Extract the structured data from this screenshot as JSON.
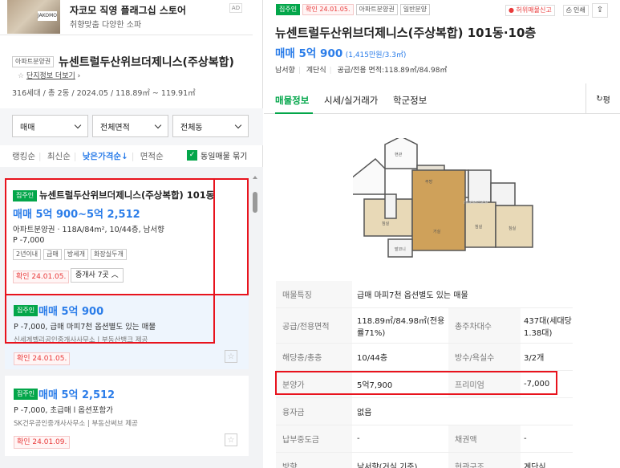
{
  "left": {
    "store": {
      "title": "자코모 직영 플래그십 스토어",
      "subtitle": "취향맞춤 다양한 소파",
      "logo_text": "JAKOMO"
    },
    "listing": {
      "type_tag": "아파트분양권",
      "name": "뉴센트럴두산위브더제니스(주상복합)",
      "complex_link": "단지정보 더보기",
      "summary": "316세대 / 총 2동 / 2024.05 / 118.89㎡ ~ 119.91㎡"
    },
    "filters": {
      "deal": "매매",
      "area": "전체면적",
      "dong": "전체동"
    },
    "sort": {
      "items": [
        "랭킹순",
        "최신순",
        "낮은가격순↓",
        "면적순"
      ],
      "group_label": "동일매물 묶기"
    },
    "cards": [
      {
        "badge": "집주인",
        "title": "뉴센트럴두산위브더제니스(주상복합) 101동",
        "price": "매매 5억 900~5억 2,512",
        "spec": "아파트분양권 · 118A/84m², 10/44층, 남서향",
        "premium": "P -7,000",
        "tags": [
          "2년이내",
          "급매",
          "방세개",
          "화장실두개"
        ],
        "confirm": "확인 24.01.05.",
        "agents": "중개사 7곳"
      },
      {
        "badge": "집주인",
        "price": "매매 5억 900",
        "desc": "P -7,000, 급매 마피7천 옵션별도 있는 매물",
        "provider": "신세계벨리공인중개사사무소 | 부동산뱅크 제공",
        "confirm": "확인 24.01.05."
      },
      {
        "badge": "집주인",
        "price": "매매 5억 2,512",
        "desc": "P -7,000, 초급매 l 옵션포함가",
        "provider": "SK건우공인중개사사무소 | 부동산써브 제공",
        "confirm": "확인 24.01.09."
      }
    ]
  },
  "right": {
    "badges": [
      "집주인",
      "확인 24.01.05.",
      "아파트분양권",
      "일반분양"
    ],
    "report": "허위매물신고",
    "print": "인쇄",
    "title": "뉴센트럴두산위브더제니스(주상복합) 101동·10층",
    "price_main": "매매 5억 900",
    "price_unit": "(1,415만원/3.3㎡)",
    "meta": [
      "남서향",
      "계단식",
      "공급/전용 면적:118.89㎡/84.98㎡"
    ],
    "tabs": [
      "매물정보",
      "시세/실거래가",
      "학군정보"
    ],
    "tab_extra": "평",
    "floorplan_watermark": "realestate",
    "details": [
      {
        "label": "매물특징",
        "value": "급매 마피7천 옵션별도 있는 매물"
      },
      {
        "label": "공급/전용면적",
        "value": "118.89㎡/84.98㎡(전용률71%)",
        "label2": "총주차대수",
        "value2": "437대(세대당 1.38대)"
      },
      {
        "label": "해당층/총층",
        "value": "10/44층",
        "label2": "방수/욕실수",
        "value2": "3/2개"
      },
      {
        "label": "분양가",
        "value": "5억7,900",
        "label2": "프리미엄",
        "value2": "-7,000"
      },
      {
        "label": "융자금",
        "value": "없음"
      },
      {
        "label": "납부중도금",
        "value": "-",
        "label2": "채권액",
        "value2": "-"
      },
      {
        "label": "방향",
        "value": "남서향(거실 기준)",
        "label2": "현관구조",
        "value2": "계단식"
      }
    ],
    "colors": {
      "green": "#03a64a",
      "blue": "#2b7de9",
      "red": "#e8131d"
    }
  }
}
